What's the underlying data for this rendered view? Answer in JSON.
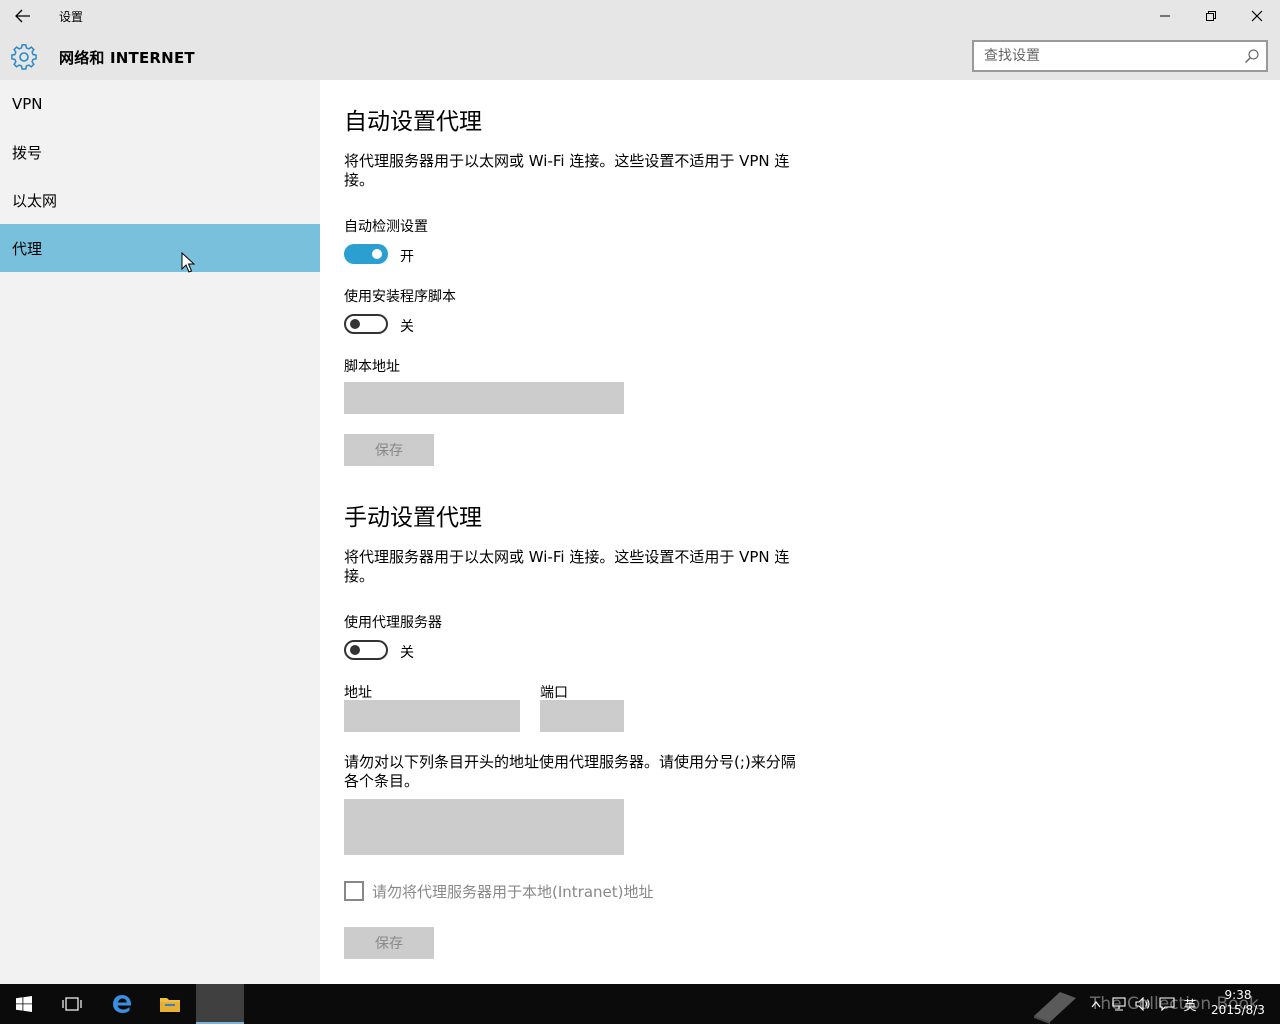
{
  "window": {
    "title": "设置",
    "back_icon": "back-arrow-icon",
    "minimize_icon": "minimize-icon",
    "restore_icon": "restore-icon",
    "close_icon": "close-icon"
  },
  "header": {
    "icon": "gear-icon",
    "title": "网络和 INTERNET",
    "search_placeholder": "查找设置",
    "search_icon": "search-icon"
  },
  "sidebar": {
    "items": [
      {
        "label": "VPN",
        "active": false
      },
      {
        "label": "拨号",
        "active": false
      },
      {
        "label": "以太网",
        "active": false
      },
      {
        "label": "代理",
        "active": true
      }
    ],
    "accent_color": "#78c0dc"
  },
  "auto_proxy": {
    "heading": "自动设置代理",
    "description": "将代理服务器用于以太网或 Wi-Fi 连接。这些设置不适用于 VPN 连接。",
    "detect_label": "自动检测设置",
    "detect_state": "开",
    "script_toggle_label": "使用安装程序脚本",
    "script_state": "关",
    "script_address_label": "脚本地址",
    "script_address_value": "",
    "save_label": "保存"
  },
  "manual_proxy": {
    "heading": "手动设置代理",
    "description": "将代理服务器用于以太网或 Wi-Fi 连接。这些设置不适用于 VPN 连接。",
    "use_proxy_label": "使用代理服务器",
    "use_proxy_state": "关",
    "address_label": "地址",
    "address_value": "",
    "port_label": "端口",
    "port_value": "",
    "exceptions_label": "请勿对以下列条目开头的地址使用代理服务器。请使用分号(;)来分隔各个条目。",
    "exceptions_value": "",
    "local_bypass_label": "请勿将代理服务器用于本地(Intranet)地址",
    "local_bypass_checked": false,
    "save_label": "保存"
  },
  "colors": {
    "toggle_on": "#2a9fd0",
    "field_bg": "#cccccc",
    "chrome_bg": "#e6e6e6",
    "sidebar_bg": "#f2f2f2"
  },
  "taskbar": {
    "items": [
      "start-icon",
      "task-view-icon",
      "edge-icon",
      "file-explorer-icon",
      "settings-app-icon"
    ],
    "tray_lang": "英",
    "clock_time": "9:38",
    "clock_date": "2015/8/3",
    "watermark": "The Collection Book"
  }
}
